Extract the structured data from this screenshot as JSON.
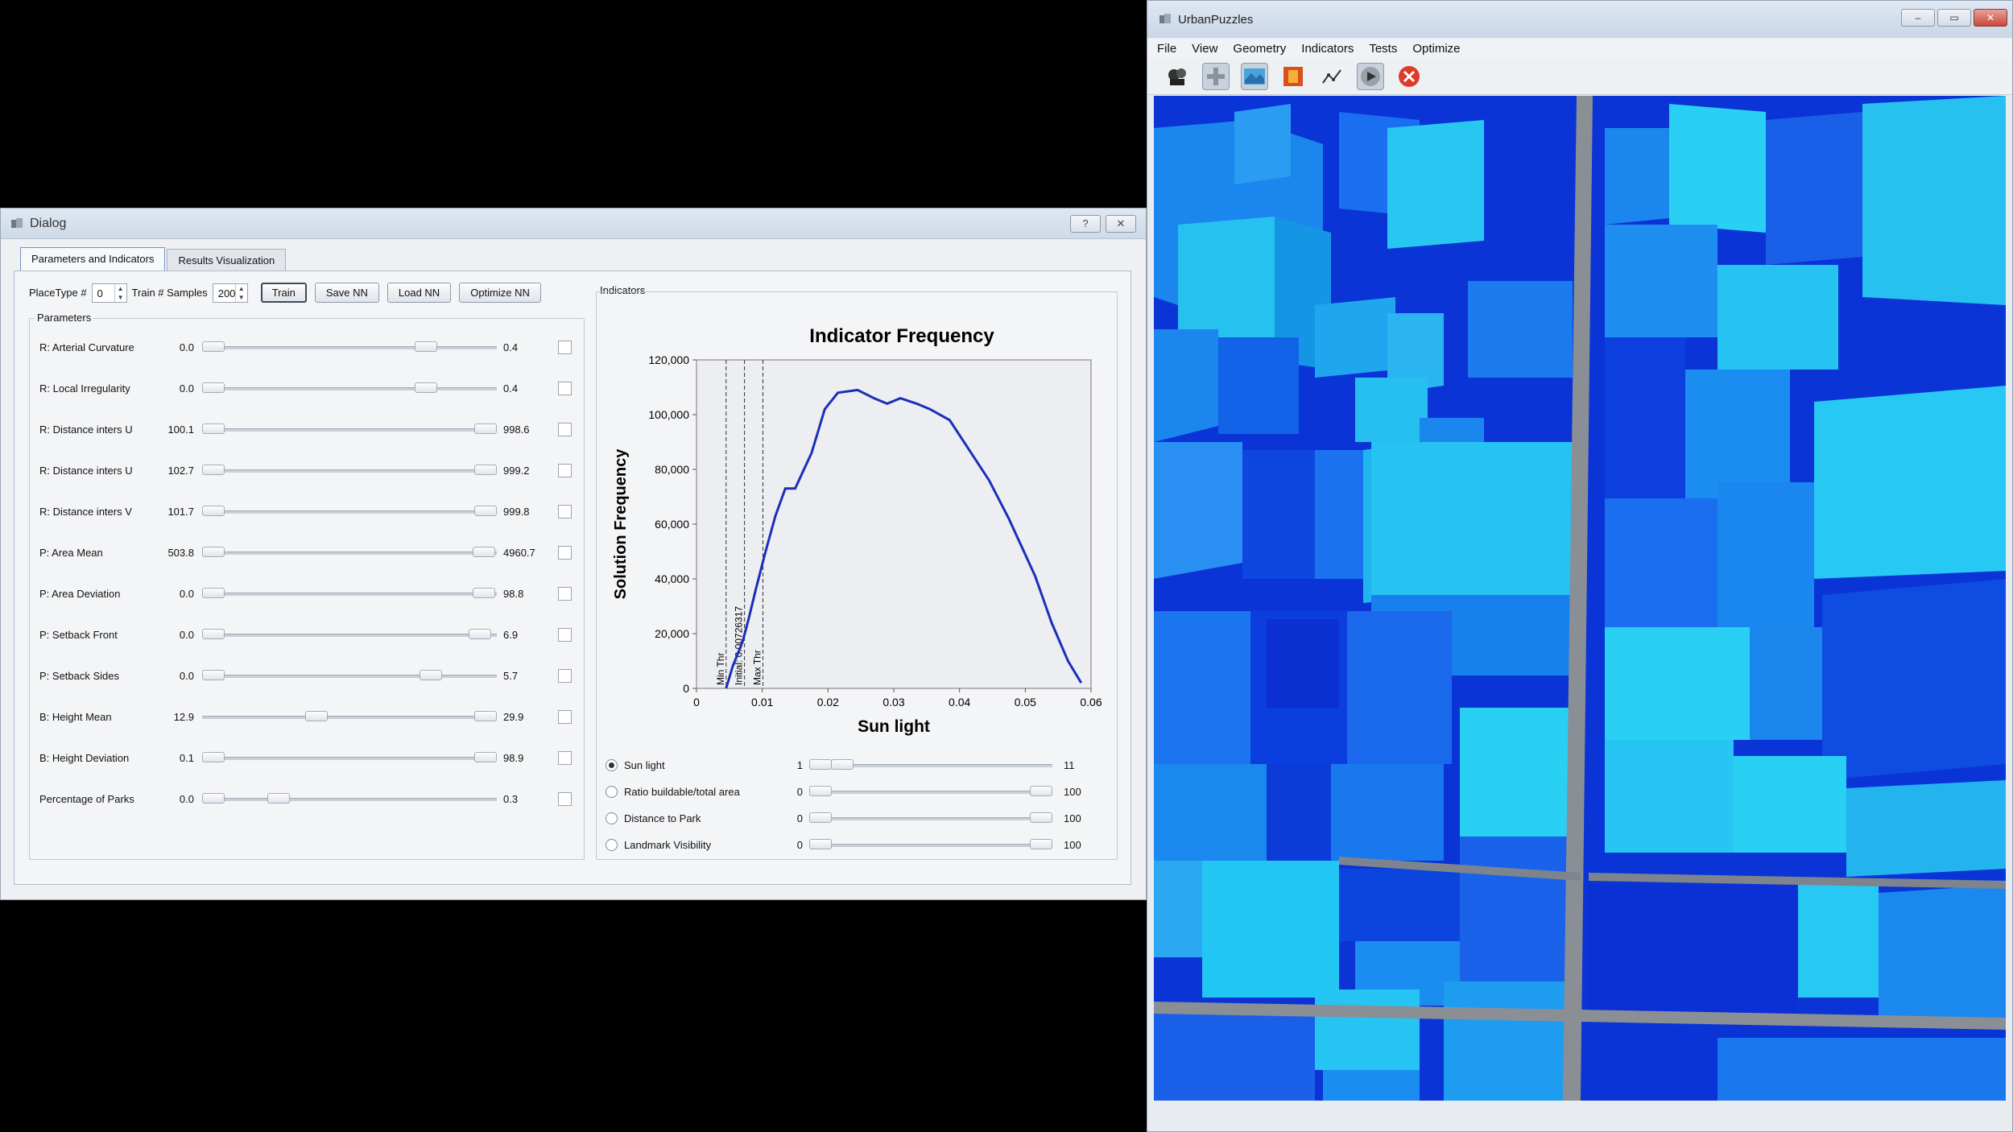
{
  "dialog": {
    "title": "Dialog",
    "help_btn": "?",
    "close_btn": "✕",
    "tabs": [
      "Parameters and Indicators",
      "Results Visualization"
    ],
    "placetype_label": "PlaceType #",
    "placetype_value": "0",
    "train_samples_label": "Train # Samples",
    "train_samples_value": "200",
    "buttons": {
      "train": "Train",
      "save": "Save NN",
      "load": "Load NN",
      "optimize": "Optimize NN"
    },
    "parameters_title": "Parameters",
    "parameters": [
      {
        "label": "R: Arterial Curvature",
        "min": "0.0",
        "max": "0.4",
        "lo": 0.0,
        "hi": 0.78
      },
      {
        "label": "R: Local Irregularity",
        "min": "0.0",
        "max": "0.4",
        "lo": 0.0,
        "hi": 0.78
      },
      {
        "label": "R: Distance inters U",
        "min": "100.1",
        "max": "998.6",
        "lo": 0.0,
        "hi": 1.0
      },
      {
        "label": "R: Distance inters U",
        "min": "102.7",
        "max": "999.2",
        "lo": 0.0,
        "hi": 1.0
      },
      {
        "label": "R: Distance inters V",
        "min": "101.7",
        "max": "999.8",
        "lo": 0.0,
        "hi": 1.0
      },
      {
        "label": "P: Area Mean",
        "min": "503.8",
        "max": "4960.7",
        "lo": 0.0,
        "hi": 0.995
      },
      {
        "label": "P: Area Deviation",
        "min": "0.0",
        "max": "98.8",
        "lo": 0.0,
        "hi": 0.995
      },
      {
        "label": "P: Setback Front",
        "min": "0.0",
        "max": "6.9",
        "lo": 0.0,
        "hi": 0.98
      },
      {
        "label": "P: Setback Sides",
        "min": "0.0",
        "max": "5.7",
        "lo": 0.0,
        "hi": 0.8
      },
      {
        "label": "B: Height Mean",
        "min": "12.9",
        "max": "29.9",
        "lo": 0.38,
        "hi": 1.0
      },
      {
        "label": "B: Height Deviation",
        "min": "0.1",
        "max": "98.9",
        "lo": 0.0,
        "hi": 1.0
      },
      {
        "label": "Percentage of Parks",
        "min": "0.0",
        "max": "0.3",
        "lo": 0.0,
        "hi": 0.24
      }
    ],
    "indicators_title": "Indicators",
    "indicators": [
      {
        "label": "Sun light",
        "min": "1",
        "max": "11",
        "lo": 0.0,
        "hi": 0.1,
        "selected": true
      },
      {
        "label": "Ratio buildable/total area",
        "min": "0",
        "max": "100",
        "lo": 0.0,
        "hi": 1.0,
        "selected": false
      },
      {
        "label": "Distance to Park",
        "min": "0",
        "max": "100",
        "lo": 0.0,
        "hi": 1.0,
        "selected": false
      },
      {
        "label": "Landmark Visibility",
        "min": "0",
        "max": "100",
        "lo": 0.0,
        "hi": 1.0,
        "selected": false
      }
    ]
  },
  "chart_data": {
    "type": "line",
    "title": "Indicator Frequency",
    "xlabel": "Sun light",
    "ylabel": "Solution Frequency",
    "xlim": [
      0,
      0.06
    ],
    "ylim": [
      0,
      120000
    ],
    "xticks": [
      "0",
      "0.01",
      "0.02",
      "0.03",
      "0.04",
      "0.05",
      "0.06"
    ],
    "yticks": [
      "0",
      "20,000",
      "40,000",
      "60,000",
      "80,000",
      "100,000",
      "120,000"
    ],
    "grid": false,
    "series": [
      {
        "x": [
          0.0045,
          0.0055,
          0.007,
          0.008,
          0.009,
          0.0105,
          0.012,
          0.0135,
          0.015,
          0.0175,
          0.0195,
          0.0215,
          0.0245,
          0.027,
          0.029,
          0.031,
          0.0335,
          0.0355,
          0.0385,
          0.0415,
          0.0445,
          0.0475,
          0.0515,
          0.054,
          0.0565,
          0.0585
        ],
        "y": [
          0,
          8000,
          17000,
          26000,
          36000,
          50000,
          63000,
          73000,
          73000,
          86000,
          102000,
          108000,
          109000,
          106000,
          104000,
          106000,
          104000,
          102000,
          98000,
          87000,
          76000,
          62000,
          41000,
          24000,
          10000,
          2000
        ]
      }
    ],
    "vlines": [
      {
        "x": 0.0045,
        "label": "Min Thr"
      },
      {
        "x": 0.0073,
        "label": "Initial: 0.00726317"
      },
      {
        "x": 0.0101,
        "label": "Max Thr"
      }
    ]
  },
  "urban": {
    "title": "UrbanPuzzles",
    "menu": [
      "File",
      "View",
      "Geometry",
      "Indicators",
      "Tests",
      "Optimize"
    ],
    "tools": [
      "camera-icon",
      "plus-icon",
      "terrain-icon",
      "render-icon",
      "graph-icon",
      "play-icon",
      "stop-icon"
    ],
    "colors": {
      "dark_blue": "#0b2fd8",
      "light_blue": "#19c4ee",
      "road": "#8a8f96"
    }
  }
}
